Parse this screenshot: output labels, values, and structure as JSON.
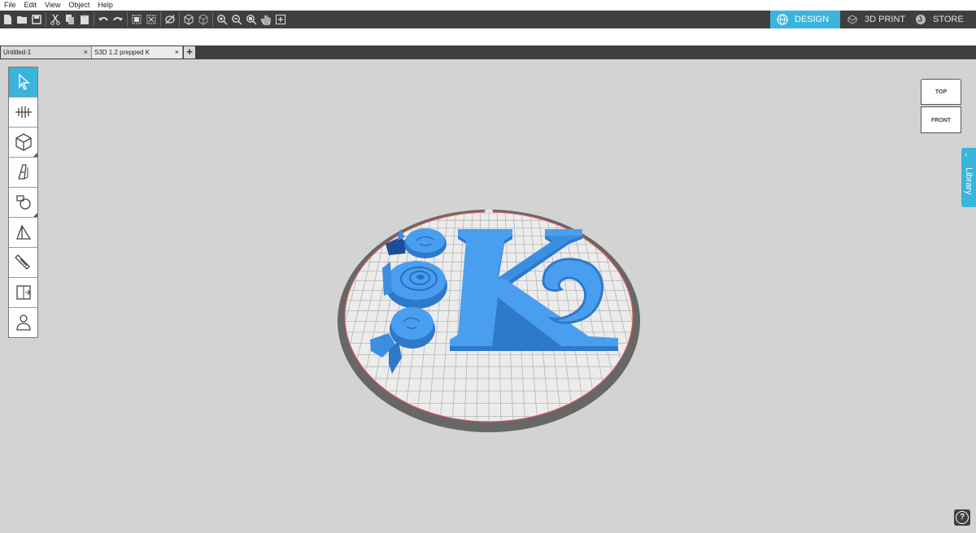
{
  "menu": [
    "File",
    "Edit",
    "View",
    "Object",
    "Help"
  ],
  "toolbar_icons": [
    "new-file-icon",
    "open-folder-icon",
    "save-icon",
    "cut-icon",
    "copy-icon",
    "paste-icon",
    "undo-icon",
    "redo-icon",
    "group-icon",
    "ungroup-icon",
    "hide-icon",
    "box-view-icon",
    "box-outline-icon",
    "zoom-in-icon",
    "zoom-out-icon",
    "zoom-fit-icon",
    "pan-hand-icon",
    "add-icon"
  ],
  "modes": {
    "design": "DESIGN",
    "print": "3D PRINT",
    "store": "STORE"
  },
  "tabs": [
    {
      "label": "Untitled-1",
      "close": "×"
    },
    {
      "label": "S3D 1.2 prepped K",
      "close": "×"
    }
  ],
  "tab_add": "+",
  "tools": [
    "select-tool",
    "align-tool",
    "shapes-tool",
    "text-tool",
    "draw-tool",
    "extrude-tool",
    "knife-tool",
    "import-tool",
    "character-tool"
  ],
  "viewcube": {
    "top": "TOP",
    "front": "FRONT"
  },
  "library": {
    "label": "Library",
    "chevron": "<"
  },
  "help": "?",
  "colors": {
    "accent": "#3ab4db",
    "model": "#3c8ee0",
    "toolbar": "#3f3f3f",
    "bed_ring": "#676767",
    "bed_edge": "#d95a5a"
  }
}
